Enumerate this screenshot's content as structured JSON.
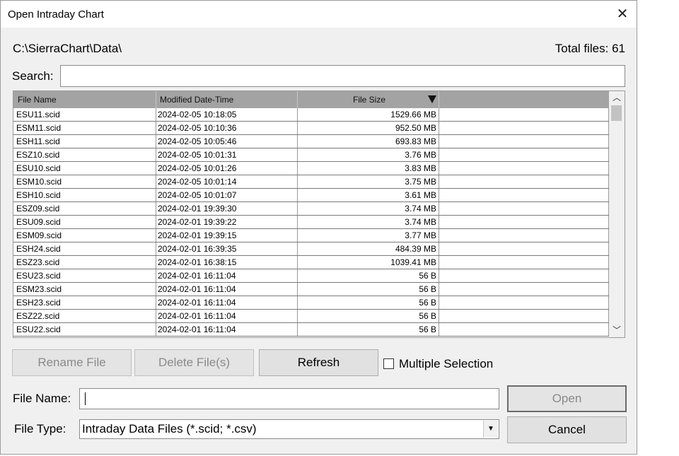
{
  "window": {
    "title": "Open Intraday Chart",
    "close_icon": "close-icon"
  },
  "path": "C:\\SierraChart\\Data\\",
  "total_files": "Total files: 61",
  "search": {
    "label": "Search:",
    "value": ""
  },
  "table": {
    "columns": [
      "File Name",
      "Modified Date-Time",
      "File Size"
    ],
    "sort_indicator": "sort-descending-icon",
    "rows": [
      {
        "name": "ESU11.scid",
        "modified": "2024-02-05  10:18:05",
        "size": "1529.66 MB"
      },
      {
        "name": "ESM11.scid",
        "modified": "2024-02-05  10:10:36",
        "size": "952.50 MB"
      },
      {
        "name": "ESH11.scid",
        "modified": "2024-02-05  10:05:46",
        "size": "693.83 MB"
      },
      {
        "name": "ESZ10.scid",
        "modified": "2024-02-05  10:01:31",
        "size": "3.76 MB"
      },
      {
        "name": "ESU10.scid",
        "modified": "2024-02-05  10:01:26",
        "size": "3.83 MB"
      },
      {
        "name": "ESM10.scid",
        "modified": "2024-02-05  10:01:14",
        "size": "3.75 MB"
      },
      {
        "name": "ESH10.scid",
        "modified": "2024-02-05  10:01:07",
        "size": "3.61 MB"
      },
      {
        "name": "ESZ09.scid",
        "modified": "2024-02-01  19:39:30",
        "size": "3.74 MB"
      },
      {
        "name": "ESU09.scid",
        "modified": "2024-02-01  19:39:22",
        "size": "3.74 MB"
      },
      {
        "name": "ESM09.scid",
        "modified": "2024-02-01  19:39:15",
        "size": "3.77 MB"
      },
      {
        "name": "ESH24.scid",
        "modified": "2024-02-01  16:39:35",
        "size": "484.39 MB"
      },
      {
        "name": "ESZ23.scid",
        "modified": "2024-02-01  16:38:15",
        "size": "1039.41 MB"
      },
      {
        "name": "ESU23.scid",
        "modified": "2024-02-01  16:11:04",
        "size": "56 B"
      },
      {
        "name": "ESM23.scid",
        "modified": "2024-02-01  16:11:04",
        "size": "56 B"
      },
      {
        "name": "ESH23.scid",
        "modified": "2024-02-01  16:11:04",
        "size": "56 B"
      },
      {
        "name": "ESZ22.scid",
        "modified": "2024-02-01  16:11:04",
        "size": "56 B"
      },
      {
        "name": "ESU22.scid",
        "modified": "2024-02-01  16:11:04",
        "size": "56 B"
      }
    ]
  },
  "buttons": {
    "rename": "Rename File",
    "delete": "Delete File(s)",
    "refresh": "Refresh",
    "open": "Open",
    "cancel": "Cancel"
  },
  "multiple_selection": {
    "label": "Multiple Selection",
    "checked": false
  },
  "file_name": {
    "label": "File Name:",
    "value": ""
  },
  "file_type": {
    "label": "File Type:",
    "value": "Intraday Data Files (*.scid; *.csv)"
  }
}
